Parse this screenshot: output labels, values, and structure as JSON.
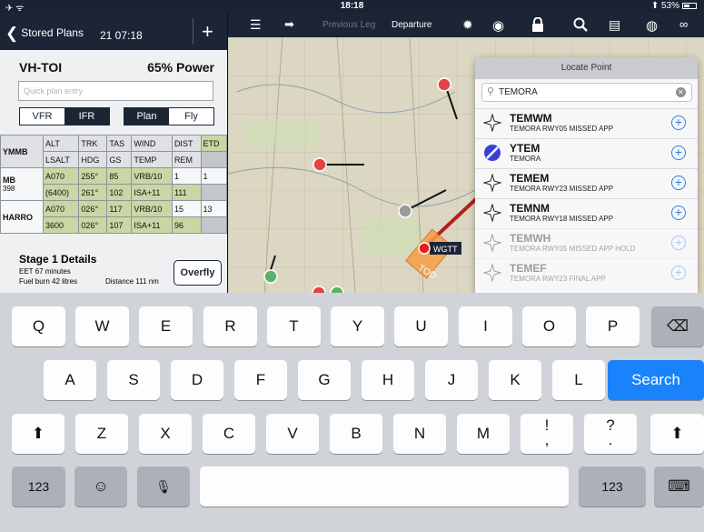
{
  "status_bar": {
    "left": "✈ ᯤ",
    "time": "18:18",
    "battery_text": "⬆ 53%",
    "battery_level": 0.53
  },
  "left_panel": {
    "back_label": "Stored Plans",
    "header_time": "21 07:18",
    "add_icon": "+",
    "registration": "VH-TOI",
    "power": "65% Power",
    "quick_entry_placeholder": "Quick plan entry",
    "rules_tabs": [
      "VFR",
      "IFR"
    ],
    "rules_selected": "IFR",
    "mode_tabs": [
      "Plan",
      "Fly"
    ],
    "mode_selected": "Plan",
    "table": {
      "row1": [
        "YMMB",
        "ALT",
        "TRK",
        "TAS",
        "WIND",
        "DIST",
        "ETD"
      ],
      "row2": [
        "",
        "LSALT",
        "HDG",
        "GS",
        "TEMP",
        "REM",
        ""
      ],
      "leg1_name": "MB",
      "leg1_num": "398",
      "leg1_a": [
        "A070",
        "255°",
        "85",
        "VRB/10",
        "1",
        "1"
      ],
      "leg1_b": [
        "(6400)",
        "261°",
        "102",
        "ISA+11",
        "111"
      ],
      "leg2_name": "HARRO",
      "leg2_a": [
        "A070",
        "026°",
        "117",
        "VRB/10",
        "15",
        "13"
      ],
      "leg2_b": [
        "3600",
        "026°",
        "107",
        "ISA+11",
        "96"
      ]
    },
    "stage": {
      "title": "Stage 1 Details",
      "eet": "EET 67 minutes",
      "fuel": "Fuel burn 42 litres",
      "distance": "Distance 111 nm",
      "overfly_label": "Overfly"
    }
  },
  "toolbar": {
    "previous_leg": "Previous Leg",
    "departure": "Departure",
    "icons": [
      "list-icon",
      "route-icon",
      "brightness-icon",
      "lifebuoy-icon",
      "lock-icon",
      "search-icon",
      "layers-icon",
      "globe-icon",
      "binoculars-icon"
    ]
  },
  "map": {
    "labels": {
      "wgtt": "WGTT",
      "tod": "TOD"
    }
  },
  "locate": {
    "title": "Locate Point",
    "query": "TEMORA",
    "results": [
      {
        "code": "TEMWM",
        "desc": "TEMORA RWY05 MISSED APP",
        "icon": "waypoint-star-icon",
        "faded": false
      },
      {
        "code": "YTEM",
        "desc": "TEMORA",
        "icon": "aerodrome-icon",
        "faded": false
      },
      {
        "code": "TEMEM",
        "desc": "TEMORA RWY23 MISSED APP",
        "icon": "waypoint-star-icon",
        "faded": false
      },
      {
        "code": "TEMNM",
        "desc": "TEMORA RWY18 MISSED APP",
        "icon": "waypoint-star-icon",
        "faded": false
      },
      {
        "code": "TEMWH",
        "desc": "TEMORA RWY05 MISSED APP HOLD",
        "icon": "waypoint-star-icon",
        "faded": true
      },
      {
        "code": "TEMEF",
        "desc": "TEMORA RWY23 FINAL APP",
        "icon": "waypoint-star-icon",
        "faded": true
      }
    ]
  },
  "keyboard": {
    "row1": [
      "Q",
      "W",
      "E",
      "R",
      "T",
      "Y",
      "U",
      "I",
      "O",
      "P"
    ],
    "row2": [
      "A",
      "S",
      "D",
      "F",
      "G",
      "H",
      "J",
      "K",
      "L"
    ],
    "row3": [
      "Z",
      "X",
      "C",
      "V",
      "B",
      "N",
      "M",
      "!\n,",
      "?\n."
    ],
    "search_label": "Search",
    "numbers_label": "123",
    "emoji": "☺",
    "mic": "🎙",
    "shift": "⬆",
    "backspace": "⌫"
  }
}
